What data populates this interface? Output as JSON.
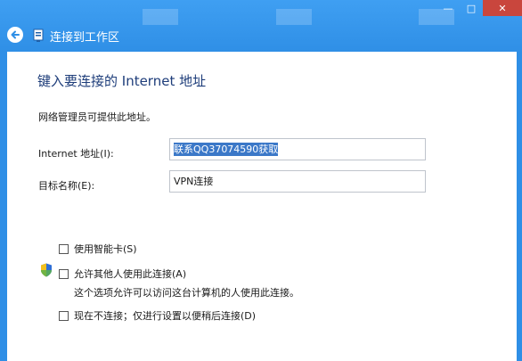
{
  "window": {
    "title": "连接到工作区",
    "controls": {
      "minimize": "—",
      "maximize": "□",
      "close": "✕"
    }
  },
  "page": {
    "heading": "键入要连接的 Internet 地址",
    "description": "网络管理员可提供此地址。"
  },
  "fields": {
    "internet_address": {
      "label": "Internet 地址(I):",
      "value": "联系QQ37074590获取"
    },
    "destination_name": {
      "label": "目标名称(E):",
      "value": "VPN连接"
    }
  },
  "options": {
    "smart_card": {
      "label": "使用智能卡(S)",
      "checked": false
    },
    "allow_others": {
      "label": "允许其他人使用此连接(A)",
      "checked": false,
      "note": "这个选项允许可以访问这台计算机的人使用此连接。"
    },
    "connect_later": {
      "label": "现在不连接；仅进行设置以便稍后连接(D)",
      "checked": false
    }
  },
  "icons": {
    "back": "back-arrow-icon",
    "network": "network-connection-icon",
    "shield": "uac-shield-icon"
  },
  "colors": {
    "titlebar": "#2f8fe6",
    "heading": "#1e3d7a",
    "selection": "#3b78c8",
    "close": "#c9463d"
  }
}
